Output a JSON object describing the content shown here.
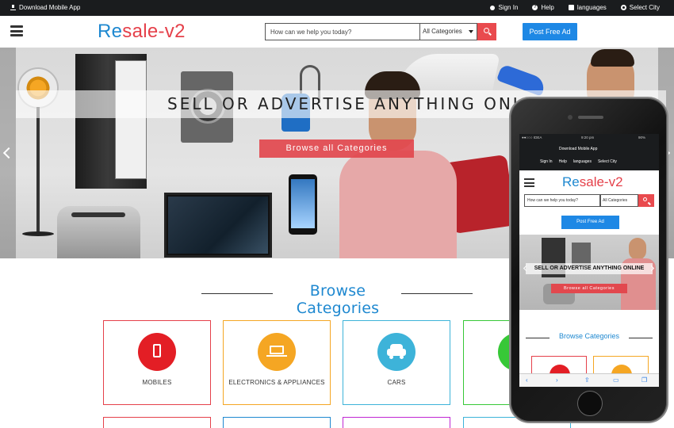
{
  "topbar": {
    "download_label": "Download Mobile App",
    "links": [
      {
        "label": "Sign In",
        "icon": "user-icon"
      },
      {
        "label": "Help",
        "icon": "help-icon"
      },
      {
        "label": "languages",
        "icon": "language-icon"
      },
      {
        "label": "Select City",
        "icon": "location-icon"
      }
    ]
  },
  "header": {
    "logo_part1": "Re",
    "logo_part2": "sale-v2",
    "search_placeholder": "How can we help you today?",
    "category_select": "All Categories",
    "post_button": "Post Free Ad"
  },
  "hero": {
    "title": "SELL OR ADVERTISE ANYTHING ONLINE",
    "cta": "Browse all Categories"
  },
  "browse": {
    "title": "Browse Categories",
    "categories": [
      {
        "label": "MOBILES",
        "icon": "mobile-icon",
        "color": "#e31e25"
      },
      {
        "label": "ELECTRONICS & APPLIANCES",
        "icon": "laptop-icon",
        "color": "#f5a623"
      },
      {
        "label": "CARS",
        "icon": "car-icon",
        "color": "#3db3d9"
      },
      {
        "label": "",
        "icon": "bike-icon",
        "color": "#37c837"
      }
    ]
  },
  "mobile": {
    "status_carrier": "●●○○○ IDEA",
    "status_time": "9:20 pm",
    "status_battery": "90%",
    "download_label": "Download Mobile App",
    "links": [
      "Sign In",
      "Help",
      "languages",
      "Select City"
    ],
    "logo_part1": "Re",
    "logo_part2": "sale-v2",
    "search_placeholder": "How can we help you today?",
    "category_select": "All Categories",
    "post_button": "Post Free Ad",
    "hero_title": "SELL OR ADVERTISE ANYTHING ONLINE",
    "hero_cta": "Browse all Categories",
    "browse_title": "Browse Categories"
  },
  "colors": {
    "brand_blue": "#1e88d0",
    "brand_red": "#e5404a",
    "topbar_bg": "#1a1c1e",
    "accent_button": "#1e88e5"
  }
}
